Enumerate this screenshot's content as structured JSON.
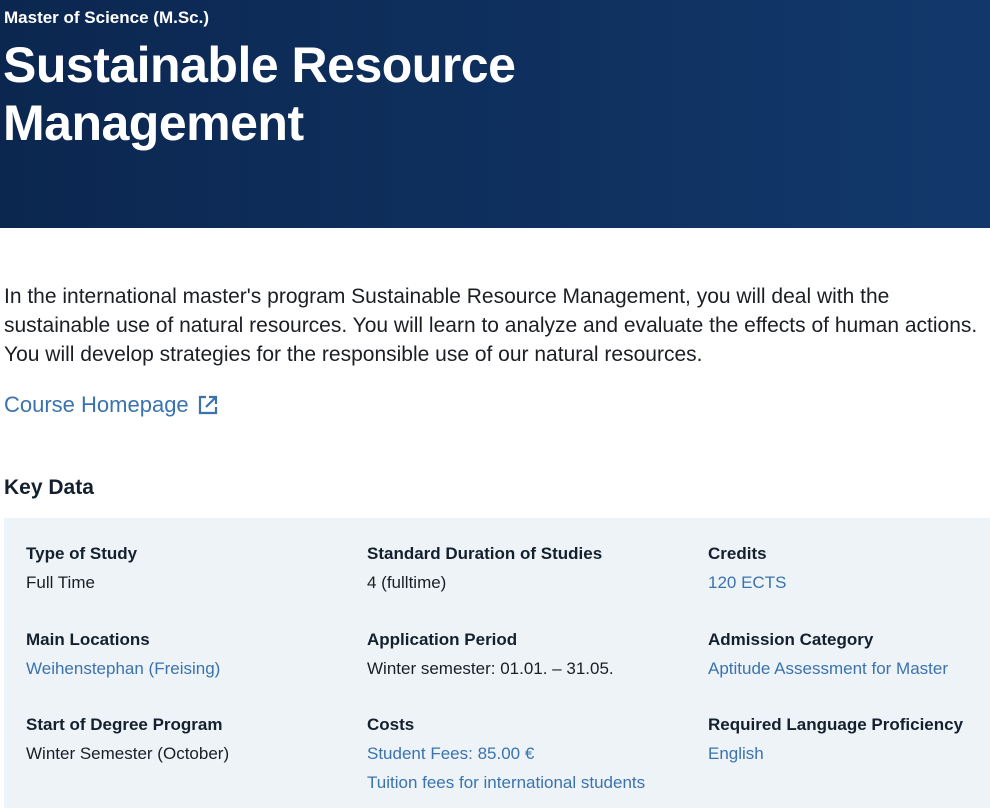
{
  "hero": {
    "degree": "Master of Science (M.Sc.)",
    "title": "Sustainable Resource Management"
  },
  "intro": "In the international master's program Sustainable Resource Management, you will deal with the sustainable use of natural resources. You will learn to analyze and evaluate the effects of human actions. You will develop strategies for the responsible use of our natural resources.",
  "course_homepage": {
    "label": "Course Homepage",
    "icon": "external-link-icon"
  },
  "key_data": {
    "title": "Key Data",
    "type_of_study": {
      "label": "Type of Study",
      "value": "Full Time"
    },
    "duration": {
      "label": "Standard Duration of Studies",
      "value": "4 (fulltime)"
    },
    "credits": {
      "label": "Credits",
      "value": "120 ECTS"
    },
    "main_locations": {
      "label": "Main Locations",
      "value": "Weihenstephan (Freising)"
    },
    "application_period": {
      "label": "Application Period",
      "value": "Winter semester: 01.01. – 31.05."
    },
    "admission_category": {
      "label": "Admission Category",
      "value": "Aptitude Assessment for Master"
    },
    "start": {
      "label": "Start of Degree Program",
      "value": "Winter Semester (October)"
    },
    "costs": {
      "label": "Costs",
      "student_fees": "Student Fees: 85.00 €",
      "tuition": "Tuition fees for international students"
    },
    "language": {
      "label": "Required Language Proficiency",
      "value": "English"
    }
  },
  "colors": {
    "hero_bg_start": "#0b2750",
    "hero_bg_end": "#12386b",
    "link": "#3a73ad",
    "panel_bg": "#eef3f8"
  }
}
